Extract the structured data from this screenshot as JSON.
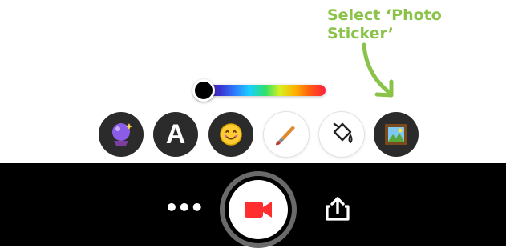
{
  "annotation": {
    "line1": "Select ‘Photo",
    "line2": "Sticker’"
  },
  "colors": {
    "annotation_green": "#8bc34a",
    "record_red": "#ff2d2d",
    "bar_background": "#000000"
  },
  "toolbar": {
    "text_tool_glyph": "A",
    "tools": [
      {
        "icon": "crystal-ball-icon"
      },
      {
        "icon": "text-icon"
      },
      {
        "icon": "smiley-face-icon"
      },
      {
        "icon": "paintbrush-icon"
      },
      {
        "icon": "paint-bucket-icon"
      },
      {
        "icon": "photo-sticker-icon"
      }
    ]
  },
  "color_slider": {
    "selected_color": "#000000"
  },
  "bottom_bar": {
    "more_glyph": "•••",
    "record_icon": "video-camera-icon",
    "share_icon": "share-upload-icon"
  }
}
